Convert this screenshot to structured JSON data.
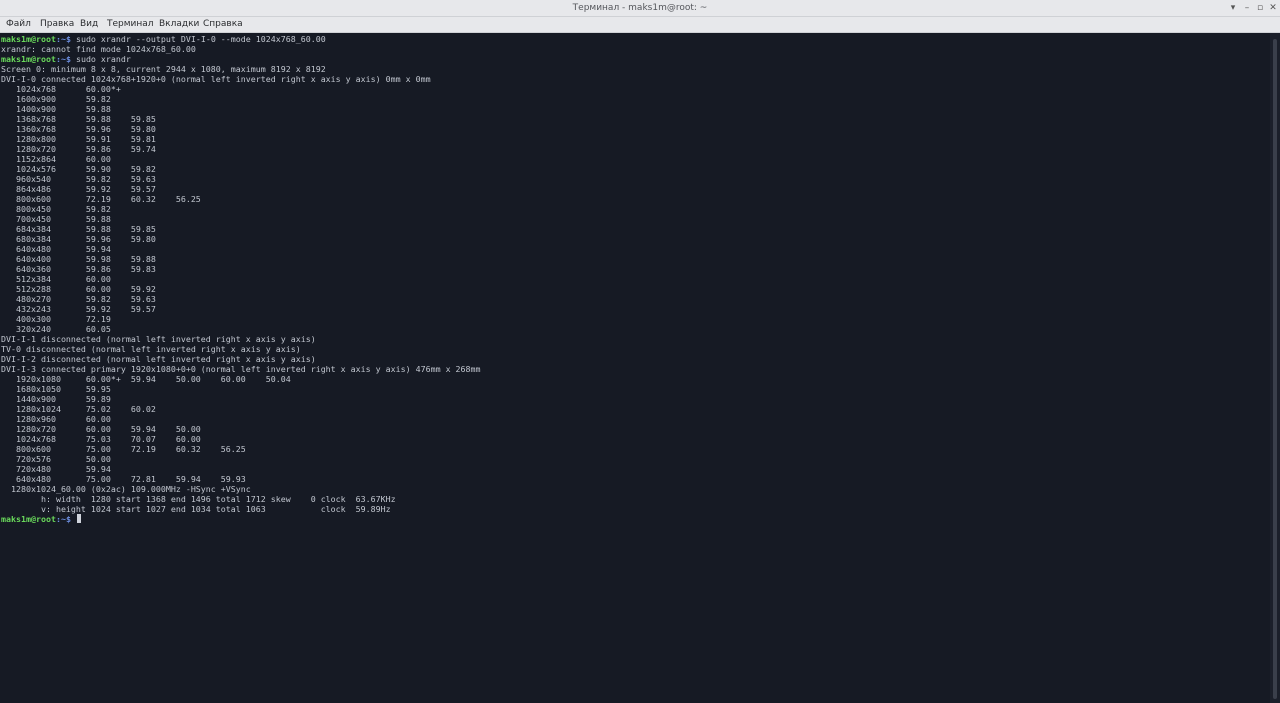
{
  "window": {
    "title": "Терминал - maks1m@root: ~",
    "controls": [
      "▾",
      "–",
      "▫",
      "✕"
    ]
  },
  "menu": [
    "Файл",
    "Правка",
    "Вид",
    "Терминал",
    "Вкладки",
    "Справка"
  ],
  "terminal": {
    "prompt_user": "maks1m@root",
    "prompt_path": ":~$",
    "lines": [
      {
        "kind": "cmd",
        "text": " sudo xrandr --output DVI-I-0 --mode 1024x768_60.00"
      },
      {
        "kind": "out",
        "text": "xrandr: cannot find mode 1024x768_60.00"
      },
      {
        "kind": "cmd",
        "text": " sudo xrandr"
      },
      {
        "kind": "out",
        "text": "Screen 0: minimum 8 x 8, current 2944 x 1080, maximum 8192 x 8192"
      },
      {
        "kind": "out",
        "text": "DVI-I-0 connected 1024x768+1920+0 (normal left inverted right x axis y axis) 0mm x 0mm"
      },
      {
        "kind": "out",
        "text": "   1024x768      60.00*+"
      },
      {
        "kind": "out",
        "text": "   1600x900      59.82"
      },
      {
        "kind": "out",
        "text": "   1400x900      59.88"
      },
      {
        "kind": "out",
        "text": "   1368x768      59.88    59.85"
      },
      {
        "kind": "out",
        "text": "   1360x768      59.96    59.80"
      },
      {
        "kind": "out",
        "text": "   1280x800      59.91    59.81"
      },
      {
        "kind": "out",
        "text": "   1280x720      59.86    59.74"
      },
      {
        "kind": "out",
        "text": "   1152x864      60.00"
      },
      {
        "kind": "out",
        "text": "   1024x576      59.90    59.82"
      },
      {
        "kind": "out",
        "text": "   960x540       59.82    59.63"
      },
      {
        "kind": "out",
        "text": "   864x486       59.92    59.57"
      },
      {
        "kind": "out",
        "text": "   800x600       72.19    60.32    56.25"
      },
      {
        "kind": "out",
        "text": "   800x450       59.82"
      },
      {
        "kind": "out",
        "text": "   700x450       59.88"
      },
      {
        "kind": "out",
        "text": "   684x384       59.88    59.85"
      },
      {
        "kind": "out",
        "text": "   680x384       59.96    59.80"
      },
      {
        "kind": "out",
        "text": "   640x480       59.94"
      },
      {
        "kind": "out",
        "text": "   640x400       59.98    59.88"
      },
      {
        "kind": "out",
        "text": "   640x360       59.86    59.83"
      },
      {
        "kind": "out",
        "text": "   512x384       60.00"
      },
      {
        "kind": "out",
        "text": "   512x288       60.00    59.92"
      },
      {
        "kind": "out",
        "text": "   480x270       59.82    59.63"
      },
      {
        "kind": "out",
        "text": "   432x243       59.92    59.57"
      },
      {
        "kind": "out",
        "text": "   400x300       72.19"
      },
      {
        "kind": "out",
        "text": "   320x240       60.05"
      },
      {
        "kind": "out",
        "text": "DVI-I-1 disconnected (normal left inverted right x axis y axis)"
      },
      {
        "kind": "out",
        "text": "TV-0 disconnected (normal left inverted right x axis y axis)"
      },
      {
        "kind": "out",
        "text": "DVI-I-2 disconnected (normal left inverted right x axis y axis)"
      },
      {
        "kind": "out",
        "text": "DVI-I-3 connected primary 1920x1080+0+0 (normal left inverted right x axis y axis) 476mm x 268mm"
      },
      {
        "kind": "out",
        "text": "   1920x1080     60.00*+  59.94    50.00    60.00    50.04"
      },
      {
        "kind": "out",
        "text": "   1680x1050     59.95"
      },
      {
        "kind": "out",
        "text": "   1440x900      59.89"
      },
      {
        "kind": "out",
        "text": "   1280x1024     75.02    60.02"
      },
      {
        "kind": "out",
        "text": "   1280x960      60.00"
      },
      {
        "kind": "out",
        "text": "   1280x720      60.00    59.94    50.00"
      },
      {
        "kind": "out",
        "text": "   1024x768      75.03    70.07    60.00"
      },
      {
        "kind": "out",
        "text": "   800x600       75.00    72.19    60.32    56.25"
      },
      {
        "kind": "out",
        "text": "   720x576       50.00"
      },
      {
        "kind": "out",
        "text": "   720x480       59.94"
      },
      {
        "kind": "out",
        "text": "   640x480       75.00    72.81    59.94    59.93"
      },
      {
        "kind": "out",
        "text": "  1280x1024_60.00 (0x2ac) 109.000MHz -HSync +VSync"
      },
      {
        "kind": "out",
        "text": "        h: width  1280 start 1368 end 1496 total 1712 skew    0 clock  63.67KHz"
      },
      {
        "kind": "out",
        "text": "        v: height 1024 start 1027 end 1034 total 1063           clock  59.89Hz"
      },
      {
        "kind": "cmd",
        "text": " "
      }
    ]
  },
  "colors": {
    "background": "#161a24",
    "text": "#c2c7d0",
    "prompt_user": "#69d85b",
    "prompt_path": "#6d8fe0"
  }
}
